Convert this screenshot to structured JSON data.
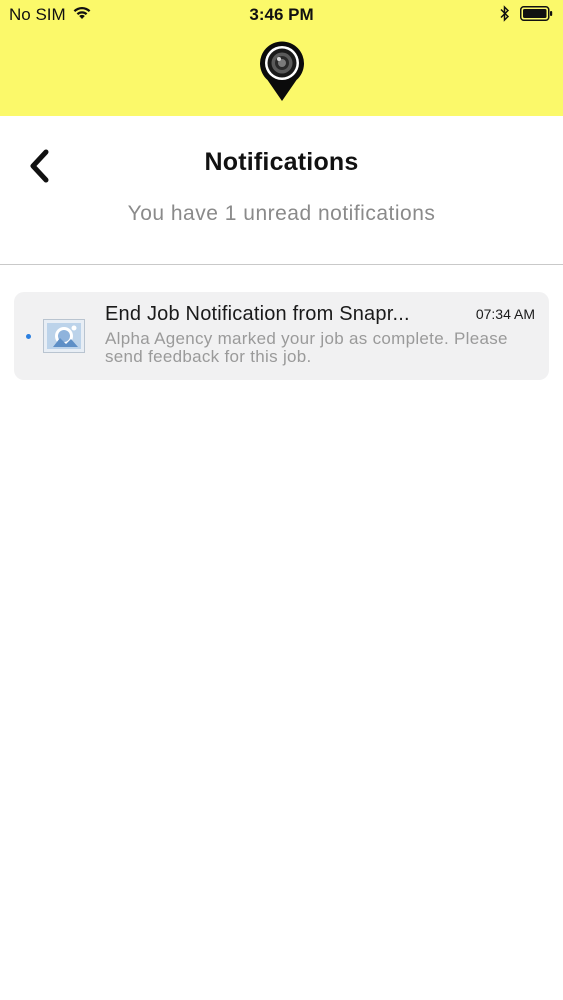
{
  "status_bar": {
    "carrier": "No SIM",
    "time": "3:46 PM",
    "icons": [
      "wifi-icon",
      "bluetooth-icon",
      "battery-icon"
    ]
  },
  "app_bar": {
    "logo": "location-pin-camera-logo",
    "background": "#fbf96a"
  },
  "header": {
    "title": "Notifications",
    "back_icon": "chevron-left-icon",
    "unread_summary": "You have 1 unread notifications"
  },
  "notifications": [
    {
      "title": "End Job Notification from Snapr...",
      "time": "07:34 AM",
      "body": "Alpha Agency marked your job as complete. Please send feedback for this job.",
      "unread": true,
      "thumbnail": "image-thumbnail-icon",
      "unread_color": "#2b7fe0"
    }
  ]
}
